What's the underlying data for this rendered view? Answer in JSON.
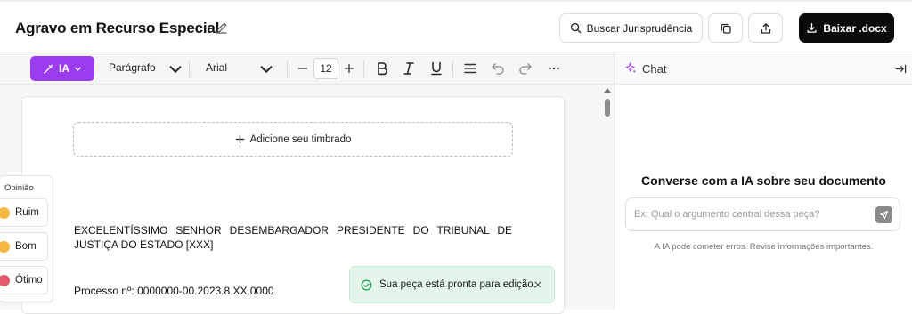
{
  "header": {
    "title": "Agravo em Recurso Especial",
    "search_label": "Buscar Jurisprudência",
    "download_label": "Baixar .docx"
  },
  "toolbar": {
    "ia_label": "IA",
    "paragraph_style": "Parágrafo",
    "font_family": "Arial",
    "font_size": "12"
  },
  "chat": {
    "title": "Chat",
    "heading": "Converse com a IA sobre seu documento",
    "input_placeholder": "Ex: Qual o argumento central dessa peça?",
    "disclaimer": "A IA pode cometer erros. Revise informações importantes."
  },
  "document": {
    "letterhead_label": "Adicione seu timbrado",
    "addressee": "EXCELENTÍSSIMO SENHOR DESEMBARGADOR PRESIDENTE DO TRIBUNAL DE JUSTIÇA DO ESTADO [XXX]",
    "process_number": "Processo nº: 0000000-00.2023.8.XX.0000"
  },
  "opinion": {
    "title": "Opinião",
    "options": [
      "Ruim",
      "Bom",
      "Ótimo"
    ]
  },
  "toast": {
    "message": "Sua peça está pronta para edição."
  },
  "colors": {
    "ia_accent": "#9a3df0",
    "download_bg": "#0b0b0b",
    "toast_bg": "#e4f6ea",
    "toast_icon": "#1f9d55"
  },
  "icons": {
    "edit": "pencil-icon",
    "search": "search-icon",
    "copy": "copy-icon",
    "share": "share-icon",
    "download": "download-icon",
    "ia": "magic-wand-icon",
    "chat": "sparkle-icon",
    "collapse": "collapse-panel-icon",
    "send": "send-icon",
    "check": "check-circle-icon",
    "close": "close-icon"
  }
}
